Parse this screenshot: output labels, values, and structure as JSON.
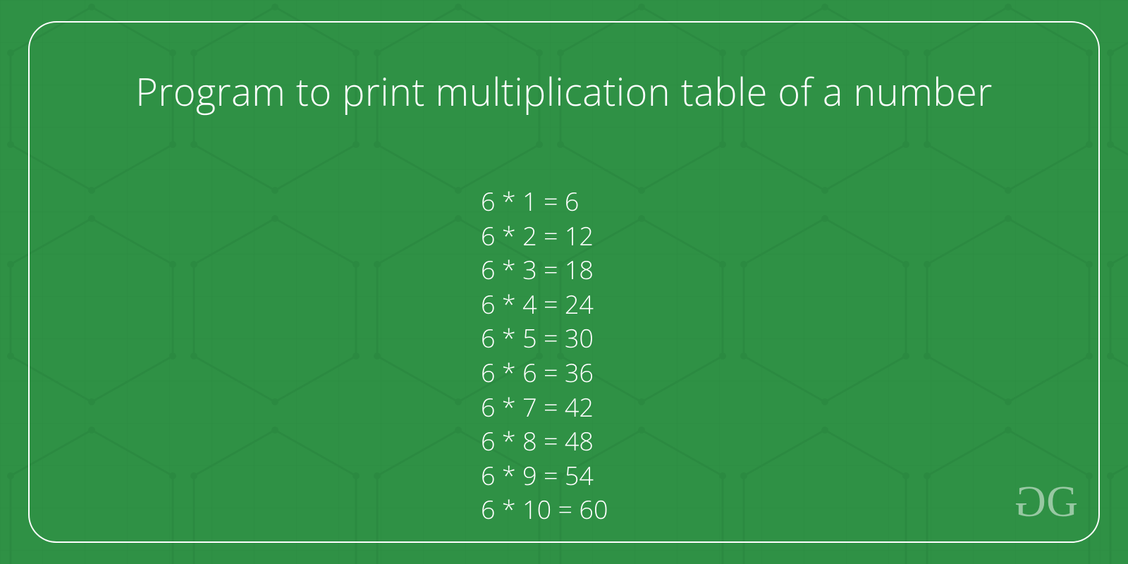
{
  "title": "Program to print multiplication table of a number",
  "table": {
    "base": 6,
    "rows": [
      {
        "i": 1,
        "text": "6 * 1 = 6"
      },
      {
        "i": 2,
        "text": "6 * 2 = 12"
      },
      {
        "i": 3,
        "text": "6 * 3 = 18"
      },
      {
        "i": 4,
        "text": "6 * 4 = 24"
      },
      {
        "i": 5,
        "text": "6 * 5 = 30"
      },
      {
        "i": 6,
        "text": "6 * 6 = 36"
      },
      {
        "i": 7,
        "text": "6 * 7 = 42"
      },
      {
        "i": 8,
        "text": "6 * 8 = 48"
      },
      {
        "i": 9,
        "text": "6 * 9 = 54"
      },
      {
        "i": 10,
        "text": "6 * 10 = 60"
      }
    ]
  },
  "logo": {
    "left": "G",
    "right": "G"
  }
}
